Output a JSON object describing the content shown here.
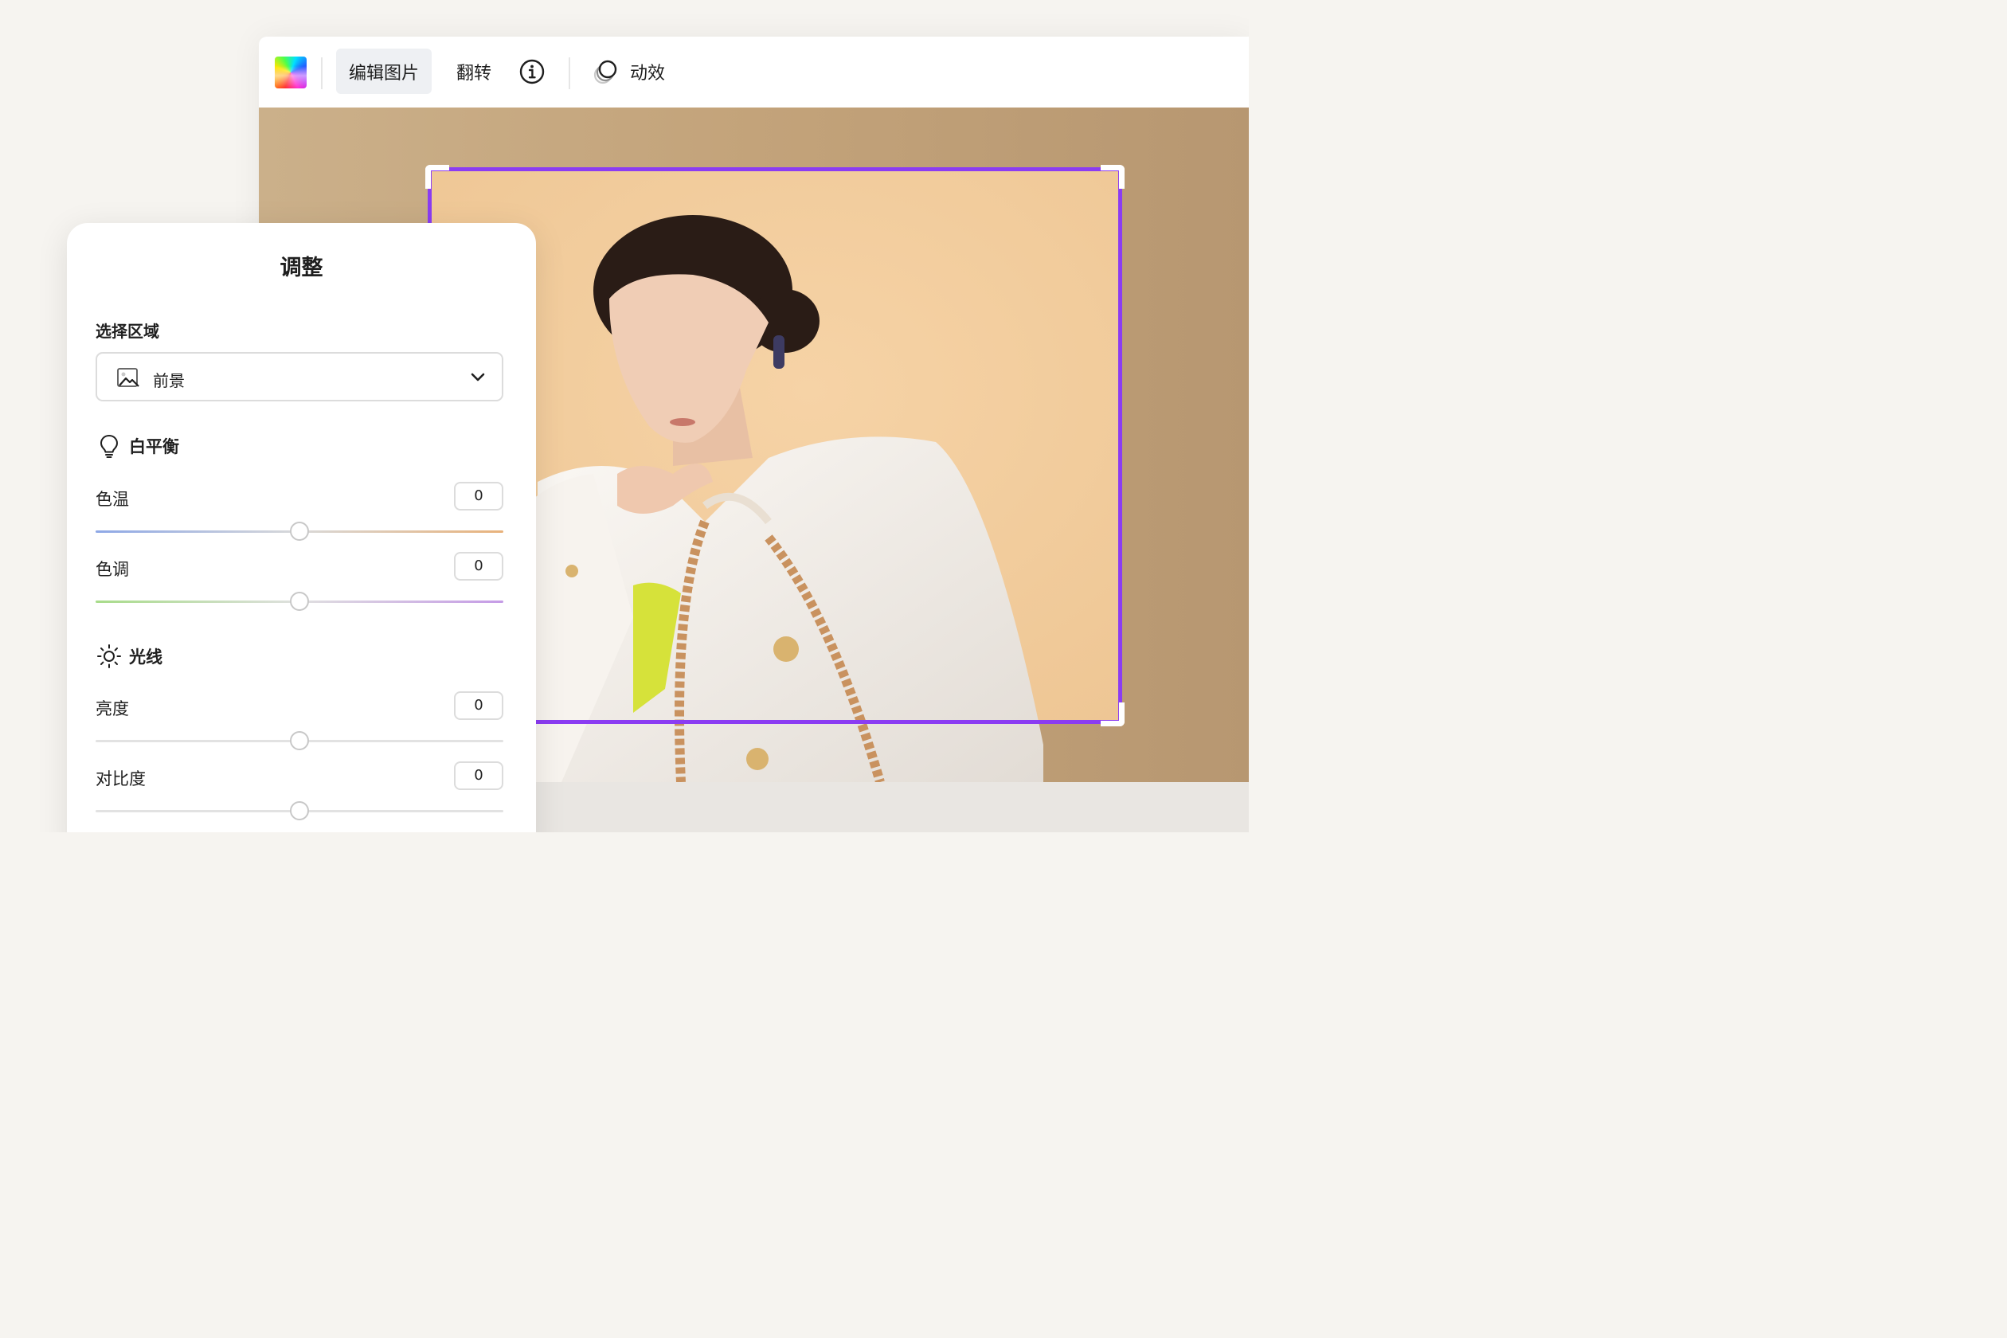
{
  "toolbar": {
    "edit_image_label": "编辑图片",
    "flip_label": "翻转",
    "effects_label": "动效"
  },
  "panel": {
    "title": "调整",
    "region_label": "选择区域",
    "region_value": "前景",
    "white_balance": {
      "title": "白平衡",
      "sliders": [
        {
          "label": "色温",
          "value": "0",
          "level": 0.5
        },
        {
          "label": "色调",
          "value": "0",
          "level": 0.5
        }
      ]
    },
    "light": {
      "title": "光线",
      "sliders": [
        {
          "label": "亮度",
          "value": "0",
          "level": 0.5
        },
        {
          "label": "对比度",
          "value": "0",
          "level": 0.5
        }
      ]
    }
  },
  "colors": {
    "selection": "#8b3cf2",
    "backdrop": "#c4a47a"
  },
  "icons": {
    "app": "color-swatch-icon",
    "info": "info-icon",
    "effects": "effects-icon",
    "region": "image-icon",
    "dropdown": "chevron-down-icon",
    "white_balance": "lightbulb-icon",
    "light": "sun-icon"
  }
}
